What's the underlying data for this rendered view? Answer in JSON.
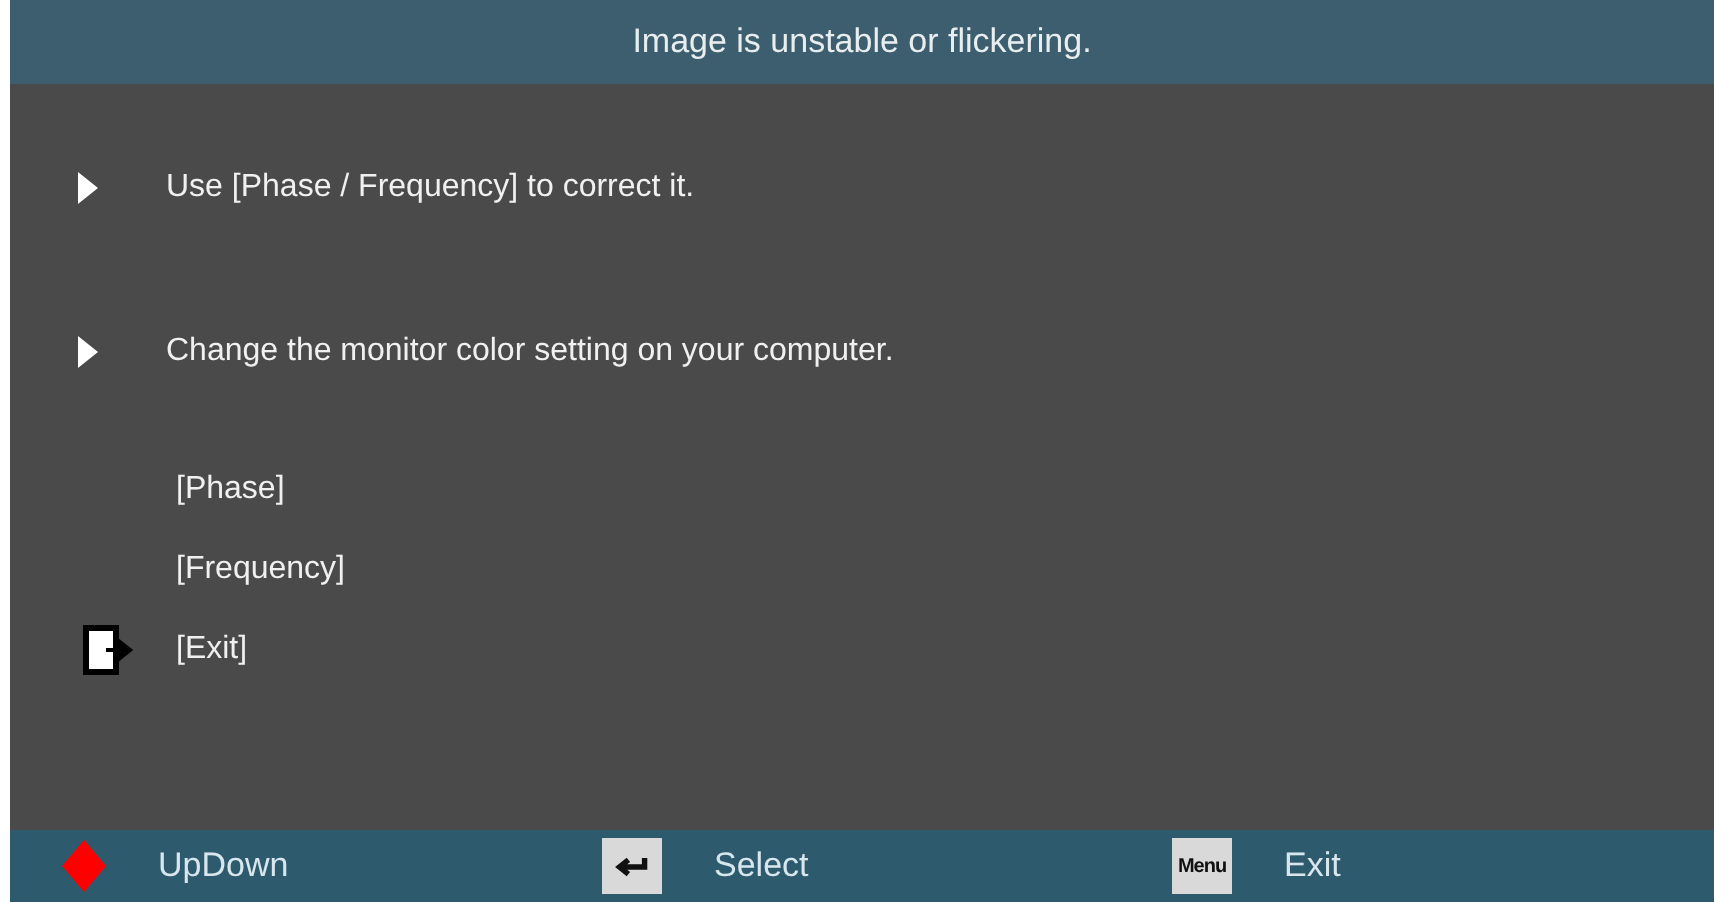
{
  "title": "Image is unstable or flickering.",
  "tips": [
    "Use [Phase / Frequency] to correct it.",
    "Change the monitor color setting on your computer."
  ],
  "options": [
    {
      "label": "[Phase]",
      "kind": "plain"
    },
    {
      "label": "[Frequency]",
      "kind": "plain"
    },
    {
      "label": "[Exit]",
      "kind": "exit"
    }
  ],
  "footer": [
    {
      "kind": "updown",
      "label": "UpDown"
    },
    {
      "kind": "enter",
      "label": "Select"
    },
    {
      "kind": "menu",
      "key": "Menu",
      "label": "Exit"
    }
  ]
}
